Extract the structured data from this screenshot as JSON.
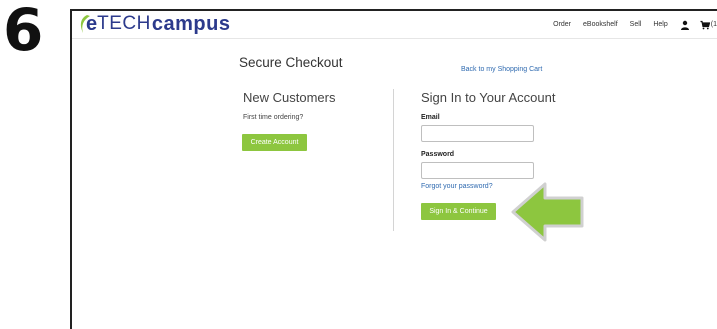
{
  "step": {
    "number": "6"
  },
  "header": {
    "logo": {
      "e": "e",
      "tech": "TECH",
      "campus": "campus"
    },
    "nav": [
      {
        "label": "Order"
      },
      {
        "label": "eBookshelf"
      },
      {
        "label": "Sell"
      },
      {
        "label": "Help"
      }
    ],
    "user_icon": "user-icon",
    "cart": {
      "icon": "cart-icon",
      "count_label": "(1"
    }
  },
  "checkout": {
    "title": "Secure Checkout",
    "back_link": "Back to my Shopping Cart"
  },
  "new_customers": {
    "heading": "New Customers",
    "subtext": "First time ordering?",
    "create_button": "Create Account"
  },
  "sign_in": {
    "heading": "Sign In to Your Account",
    "email_label": "Email",
    "email_value": "",
    "password_label": "Password",
    "password_value": "",
    "forgot_link": "Forgot your password?",
    "submit_button": "Sign In & Continue"
  },
  "annotation": {
    "arrow_icon": "arrow-left-icon"
  },
  "colors": {
    "accent_green": "#8dc63f",
    "link_blue": "#2f6ab0",
    "brand_blue": "#2c3a8c",
    "arrow_green": "#8dc63f"
  }
}
